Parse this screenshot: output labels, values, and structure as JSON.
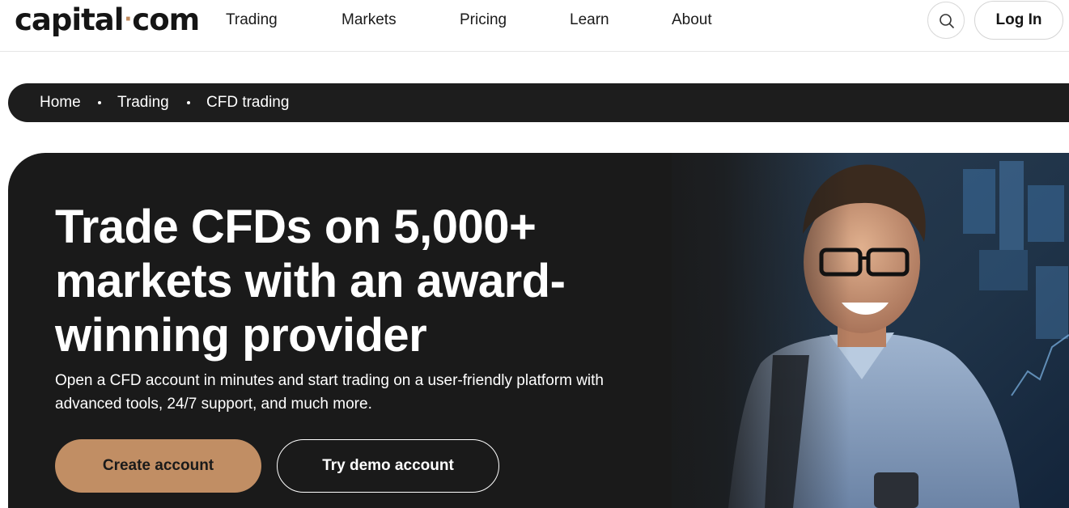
{
  "header": {
    "logo_left": "capital",
    "logo_dot": "·",
    "logo_right": "com",
    "nav": [
      "Trading",
      "Markets",
      "Pricing",
      "Learn",
      "About"
    ],
    "search_icon": "search-icon",
    "login_label": "Log In"
  },
  "breadcrumb": [
    "Home",
    "Trading",
    "CFD trading"
  ],
  "hero": {
    "title": "Trade CFDs on 5,000+ markets with an award-winning provider",
    "subtitle": "Open a CFD account in minutes and start trading on a user-friendly platform with advanced tools, 24/7 support, and much more.",
    "primary_cta": "Create account",
    "secondary_cta": "Try demo account"
  },
  "colors": {
    "accent": "#c18e64",
    "dark": "#1a1a1a",
    "text": "#151515"
  }
}
